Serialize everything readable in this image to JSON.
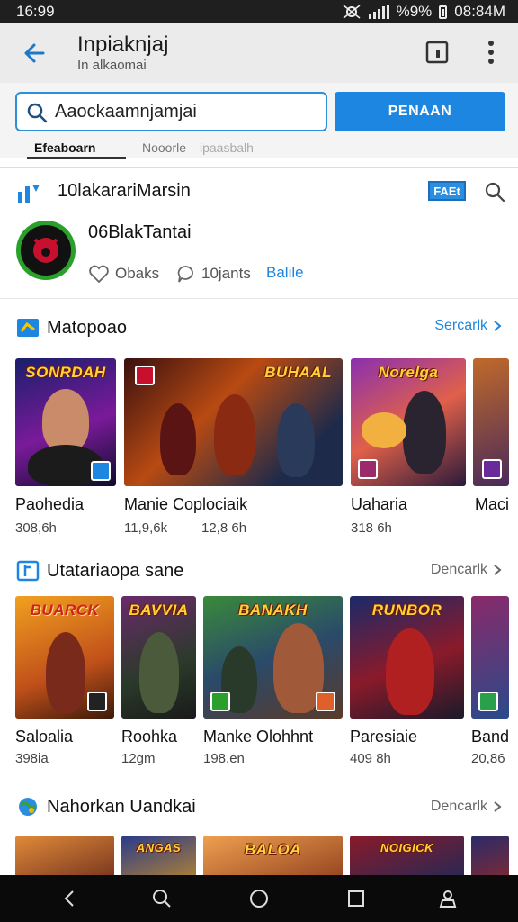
{
  "status_bar": {
    "time": "16:99",
    "battery": "%9%",
    "clock": "08:84M"
  },
  "app_bar": {
    "title": "Inpiaknjaj",
    "subtitle": "In alkaomai"
  },
  "search": {
    "value": "Aaockaamnjamjai",
    "button_label": "PENAAN"
  },
  "tabs": [
    {
      "label": "Efeaboarn"
    },
    {
      "label": "Nooorle"
    },
    {
      "label": "ipaasbalh"
    }
  ],
  "channel": {
    "name": "10lakarariMarsin",
    "badge": "FAEt",
    "user_name": "06BlakTantai",
    "actions": [
      {
        "label": "Obaks"
      },
      {
        "label": "10jants"
      },
      {
        "label": "Balile"
      }
    ]
  },
  "sections": [
    {
      "title": "Matopoao",
      "more": "Sercarlk",
      "more_color": "#1d86e0",
      "items": [
        {
          "title": "Paohedia",
          "meta": "308,6h",
          "banner": "SONRDAH"
        },
        {
          "title": "Manie Coplociaik",
          "meta": "11,9,6k",
          "meta2": "12,8 6h",
          "banner": "BUHAAL"
        },
        {
          "title": "Uaharia",
          "meta": "318 6h",
          "banner": "Norelga"
        },
        {
          "title": "Maci",
          "meta": "",
          "banner": ""
        }
      ]
    },
    {
      "title": "Utatariaopa sane",
      "more": "Dencarlk",
      "more_color": "#666666",
      "items": [
        {
          "title": "Saloalia",
          "meta": "398ia",
          "banner": "BUARCK"
        },
        {
          "title": "Roohka",
          "meta": "12gm",
          "banner": "BAVVIA"
        },
        {
          "title": "Manke Olohhnt",
          "meta": "198.en",
          "banner": "BANAKH"
        },
        {
          "title": "Paresiaie",
          "meta": "409 8h",
          "banner": "RUNBOR"
        },
        {
          "title": "Band",
          "meta": "20,86",
          "banner": ""
        }
      ]
    },
    {
      "title": "Nahorkan Uandkai",
      "more": "Dencarlk",
      "more_color": "#666666",
      "items": [
        {
          "banner": ""
        },
        {
          "banner": "ANGAS"
        },
        {
          "banner": "BALOA"
        },
        {
          "banner": "NOIGICK"
        },
        {
          "banner": ""
        }
      ]
    }
  ]
}
